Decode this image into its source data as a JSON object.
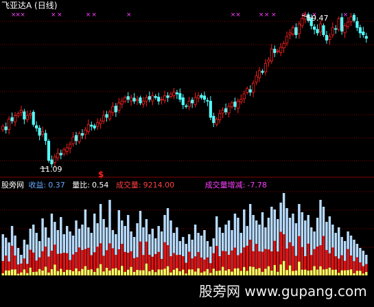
{
  "header": {
    "title": "飞亚达A (日线)"
  },
  "price_panel": {
    "high_label": "19.47",
    "low_label": "11.09",
    "signal_label": "$",
    "close_series": [
      13.2,
      13.0,
      13.6,
      13.5,
      13.8,
      13.9,
      14.1,
      13.6,
      13.8,
      13.9,
      13.3,
      13.1,
      12.7,
      12.9,
      12.4,
      11.3,
      11.1,
      11.5,
      11.7,
      11.6,
      11.9,
      12.0,
      12.2,
      12.6,
      12.4,
      12.8,
      12.7,
      13.0,
      13.3,
      13.2,
      13.1,
      13.4,
      13.5,
      13.8,
      13.7,
      14.0,
      14.3,
      14.0,
      14.5,
      14.6,
      14.8,
      14.7,
      14.8,
      14.6,
      14.7,
      14.5,
      14.6,
      14.8,
      14.7,
      14.9,
      14.8,
      14.6,
      14.7,
      14.9,
      14.8,
      15.0,
      15.1,
      15.0,
      14.7,
      14.4,
      14.3,
      14.6,
      14.5,
      14.8,
      14.9,
      14.8,
      14.7,
      14.6,
      13.7,
      13.4,
      13.6,
      13.9,
      14.1,
      14.0,
      14.3,
      14.5,
      14.3,
      14.6,
      14.7,
      15.0,
      15.3,
      15.1,
      15.6,
      16.0,
      16.3,
      16.2,
      16.7,
      16.9,
      17.5,
      17.3,
      17.4,
      17.6,
      17.8,
      18.2,
      18.4,
      18.7,
      18.3,
      18.9,
      19.2,
      19.4,
      19.1,
      18.8,
      18.6,
      18.4,
      18.9,
      18.3,
      18.0,
      18.2,
      18.7,
      18.6,
      19.2,
      18.5,
      18.8,
      19.0,
      19.3,
      19.1,
      18.7,
      18.4,
      18.3,
      18.1
    ],
    "magenta_markers": [
      0.033,
      0.045,
      0.058,
      0.142,
      0.159,
      0.237,
      0.253,
      0.348,
      0.632,
      0.646,
      0.709,
      0.724,
      0.743,
      0.827,
      0.854,
      0.939
    ],
    "signal_index": 32
  },
  "indicator": {
    "site_name": "股旁网",
    "shouyi_label": "收益:",
    "shouyi_value": "0.37",
    "liangbi_label": "量比:",
    "liangbi_value": "0.54",
    "volume_label": "成交量:",
    "volume_value": "9214.00",
    "vol_change_label": "成交量增减:",
    "vol_change_value": "-7.78",
    "volume_series": [
      60,
      55,
      48,
      72,
      58,
      40,
      30,
      52,
      45,
      68,
      74,
      62,
      50,
      83,
      70,
      55,
      90,
      78,
      66,
      85,
      60,
      72,
      64,
      58,
      80,
      68,
      74,
      96,
      70,
      62,
      90,
      76,
      104,
      82,
      70,
      110,
      66,
      60,
      95,
      80,
      72,
      88,
      64,
      56,
      76,
      94,
      70,
      82,
      60,
      68,
      54,
      72,
      64,
      88,
      98,
      80,
      62,
      70,
      50,
      56,
      46,
      60,
      52,
      74,
      62,
      58,
      66,
      50,
      42,
      54,
      86,
      70,
      62,
      74,
      80,
      66,
      90,
      84,
      62,
      96,
      72,
      104,
      88,
      80,
      74,
      92,
      70,
      84,
      100,
      96,
      82,
      106,
      120,
      98,
      84,
      90,
      76,
      104,
      92,
      80,
      88,
      70,
      64,
      84,
      110,
      100,
      78,
      86,
      74,
      62,
      70,
      56,
      50,
      64,
      58,
      52,
      46,
      40,
      36,
      30
    ]
  },
  "watermark": {
    "text": "股旁网 www.gupang.com"
  },
  "colors": {
    "up": "#ff2020",
    "down": "#54ffff",
    "marker": "#ff40ff",
    "vol_outer": "#b8dcff",
    "vol_mid": "#e01010",
    "vol_inner": "#ffff60",
    "grid": "#8a0000",
    "shouyi": "#66aaff",
    "liangbi": "#ffffff",
    "volume": "#ff4040",
    "vol_change": "#ff40ff"
  }
}
